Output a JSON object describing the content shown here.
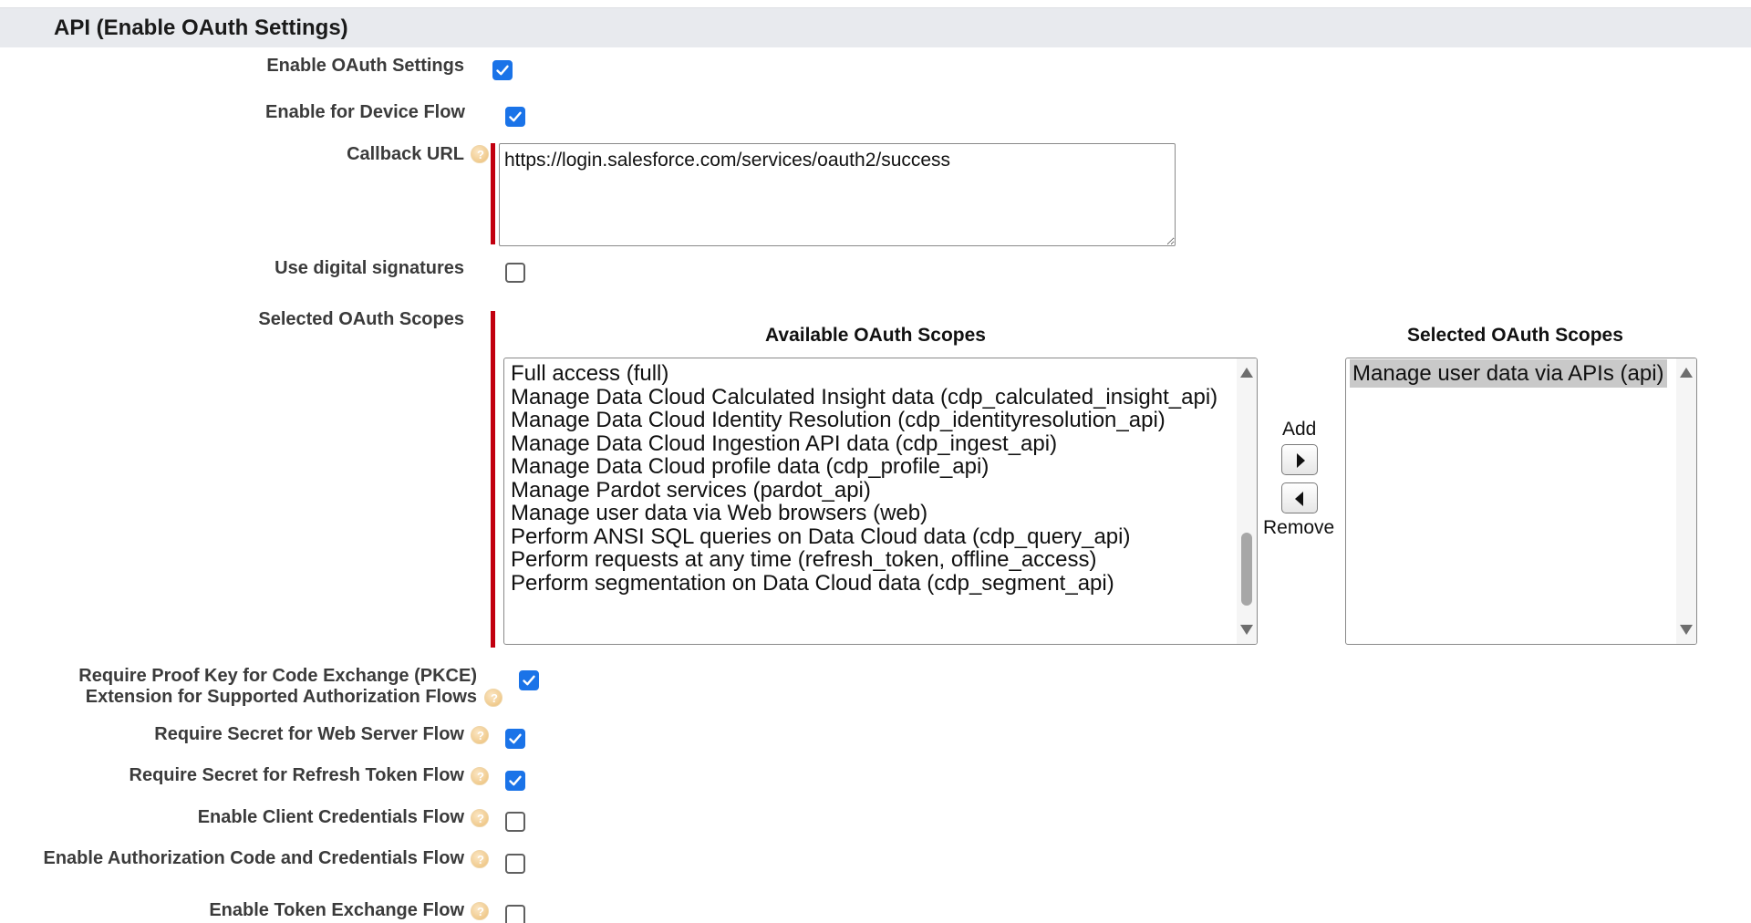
{
  "section": {
    "title": "API (Enable OAuth Settings)"
  },
  "fields": {
    "enable_oauth": {
      "label": "Enable OAuth Settings",
      "checked": true
    },
    "device_flow": {
      "label": "Enable for Device Flow",
      "checked": true
    },
    "callback_url": {
      "label": "Callback URL",
      "value": "https://login.salesforce.com/services/oauth2/success"
    },
    "digital_signatures": {
      "label": "Use digital signatures",
      "checked": false
    },
    "oauth_scopes": {
      "label": "Selected OAuth Scopes"
    },
    "pkce": {
      "label_line1": "Require Proof Key for Code Exchange (PKCE)",
      "label_line2": "Extension for Supported Authorization Flows",
      "checked": true
    },
    "secret_web_server": {
      "label": "Require Secret for Web Server Flow",
      "checked": true
    },
    "secret_refresh": {
      "label": "Require Secret for Refresh Token Flow",
      "checked": true
    },
    "client_credentials": {
      "label": "Enable Client Credentials Flow",
      "checked": false
    },
    "auth_code_credentials": {
      "label": "Enable Authorization Code and Credentials Flow",
      "checked": false
    },
    "token_exchange": {
      "label": "Enable Token Exchange Flow",
      "checked": false
    }
  },
  "scopes": {
    "available_title": "Available OAuth Scopes",
    "selected_title": "Selected OAuth Scopes",
    "available": [
      "Full access (full)",
      "Manage Data Cloud Calculated Insight data (cdp_calculated_insight_api)",
      "Manage Data Cloud Identity Resolution (cdp_identityresolution_api)",
      "Manage Data Cloud Ingestion API data (cdp_ingest_api)",
      "Manage Data Cloud profile data (cdp_profile_api)",
      "Manage Pardot services (pardot_api)",
      "Manage user data via Web browsers (web)",
      "Perform ANSI SQL queries on Data Cloud data (cdp_query_api)",
      "Perform requests at any time (refresh_token, offline_access)",
      "Perform segmentation on Data Cloud data (cdp_segment_api)"
    ],
    "selected": [
      "Manage user data via APIs (api)"
    ],
    "add_label": "Add",
    "remove_label": "Remove"
  },
  "icons": {
    "help": "help-icon",
    "add": "arrow-right-icon",
    "remove": "arrow-left-icon"
  },
  "colors": {
    "checkbox_checked": "#1a73e8",
    "required_bar": "#c2000f",
    "section_bg": "#e8eaee",
    "help_icon": "#f2cf96",
    "selected_item_bg": "#c9c9c9"
  }
}
